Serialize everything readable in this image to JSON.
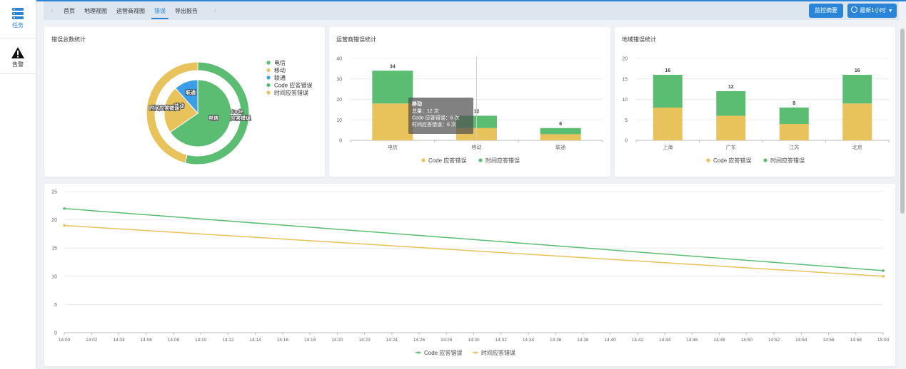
{
  "sidebar": {
    "items": [
      {
        "label": "任务",
        "icon": "server-stack-icon",
        "active": true
      },
      {
        "label": "告警",
        "icon": "warning-triangle-icon",
        "active": false
      }
    ]
  },
  "tabs": {
    "items": [
      "首页",
      "地理视图",
      "运营商视图",
      "错误",
      "导出报告"
    ],
    "active": "错误"
  },
  "header": {
    "summary_button": "监控摘要",
    "time_button": "最新1小时"
  },
  "colors": {
    "green": "#5bbd72",
    "yellow": "#e8c25a",
    "blue": "#3a9fe6",
    "accent": "#2a84d8"
  },
  "cards": {
    "pie_title": "错误总数统计",
    "operator_title": "运营商错误统计",
    "region_title": "地域错误统计"
  },
  "chart_data": [
    {
      "type": "pie",
      "title": "错误总数统计",
      "inner": [
        {
          "name": "电信",
          "value": 34,
          "color": "#5bbd72"
        },
        {
          "name": "移动",
          "value": 12,
          "color": "#e8c25a"
        },
        {
          "name": "联通",
          "value": 6,
          "color": "#3a9fe6"
        }
      ],
      "outer": [
        {
          "name": "Code 应答错误",
          "value": 54,
          "color": "#5bbd72"
        },
        {
          "name": "时间应答错误",
          "value": 46,
          "color": "#e8c25a"
        }
      ],
      "inner_labels": [
        "电信",
        "移动",
        "联通"
      ],
      "outer_labels": [
        "Code 应答错误",
        "时间应答错误"
      ],
      "legend": [
        {
          "name": "电信",
          "color": "#5bbd72"
        },
        {
          "name": "移动",
          "color": "#e8c25a"
        },
        {
          "name": "联通",
          "color": "#3a9fe6"
        },
        {
          "name": "Code 应答错误",
          "color": "#5bbd72"
        },
        {
          "name": "时间应答错误",
          "color": "#e8c25a"
        }
      ],
      "legend_position": "right"
    },
    {
      "type": "bar",
      "title": "运营商错误统计",
      "categories": [
        "电信",
        "移动",
        "联通"
      ],
      "series": [
        {
          "name": "Code 应答错误",
          "values": [
            18,
            6,
            3
          ],
          "color": "#e8c25a"
        },
        {
          "name": "时间应答错误",
          "values": [
            16,
            6,
            3
          ],
          "color": "#5bbd72"
        }
      ],
      "totals": [
        34,
        12,
        6
      ],
      "ylim": [
        0,
        40
      ],
      "yticks": [
        0,
        10,
        20,
        30,
        40
      ],
      "legend_position": "bottom",
      "tooltip": {
        "title": "移动",
        "lines": [
          "总量：12 次",
          "Code 应答错误：6 次",
          "时间应答错误：6 次"
        ]
      }
    },
    {
      "type": "bar",
      "title": "地域错误统计",
      "categories": [
        "上海",
        "广东",
        "江苏",
        "北京"
      ],
      "series": [
        {
          "name": "Code 应答错误",
          "values": [
            8,
            6,
            4,
            9
          ],
          "color": "#e8c25a"
        },
        {
          "name": "时间应答错误",
          "values": [
            8,
            6,
            4,
            7
          ],
          "color": "#5bbd72"
        }
      ],
      "totals": [
        16,
        12,
        8,
        16
      ],
      "ylim": [
        0,
        20
      ],
      "yticks": [
        0,
        5,
        10,
        15,
        20
      ],
      "legend_position": "bottom"
    },
    {
      "type": "line",
      "x": [
        "14:00",
        "14:02",
        "14:04",
        "14:06",
        "14:08",
        "14:10",
        "14:12",
        "14:14",
        "14:16",
        "14:18",
        "14:20",
        "14:22",
        "14:24",
        "14:26",
        "14:28",
        "14:30",
        "14:32",
        "14:34",
        "14:36",
        "14:38",
        "14:40",
        "14:42",
        "14:44",
        "14:46",
        "14:48",
        "14:50",
        "14:52",
        "14:54",
        "14:56",
        "14:58",
        "15:00"
      ],
      "series": [
        {
          "name": "Code 应答错误",
          "points": [
            [
              "14:00",
              22
            ],
            [
              "15:00",
              11
            ]
          ],
          "color": "#5bbd72"
        },
        {
          "name": "时间应答错误",
          "points": [
            [
              "14:00",
              19
            ],
            [
              "15:00",
              10
            ]
          ],
          "color": "#e8c25a"
        }
      ],
      "ylim": [
        0,
        25
      ],
      "yticks": [
        0,
        5,
        10,
        15,
        20,
        25
      ],
      "legend_position": "bottom"
    }
  ]
}
